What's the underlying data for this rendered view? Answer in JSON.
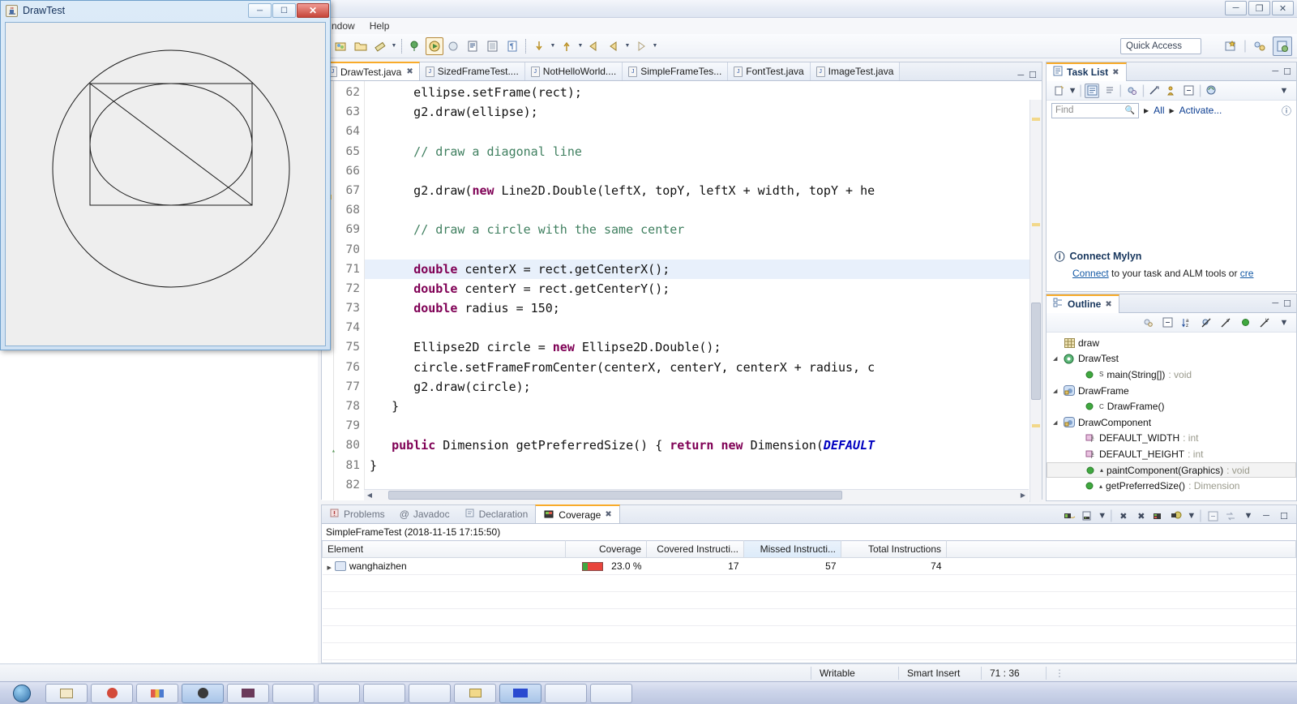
{
  "eclipse": {
    "window_buttons": [
      "minimize",
      "maximize",
      "close"
    ],
    "menu": [
      "ndow",
      "Help"
    ],
    "toolbar_icons": [
      "new-wizard-icon",
      "open-folder-icon",
      "save-icon",
      "dropdown-arrow",
      "debug-icon",
      "run-icon",
      "coverage-icon",
      "external-tools-icon",
      "new-java-class-icon",
      "open-type-icon",
      "toggle-markoccurrences-icon",
      "search-icon",
      "dropdown-arrow",
      "next-annotation-icon",
      "dropdown-arrow",
      "back-icon",
      "forward-icon",
      "dropdown-arrow",
      "forward2-icon",
      "dropdown-arrow"
    ],
    "quick_access": "Quick Access",
    "perspective_icons": [
      "new-perspective-icon",
      "java-perspective-icon",
      "java-ee-perspective-icon"
    ]
  },
  "editor": {
    "tabs": [
      {
        "label": "DrawTest.java",
        "active": true,
        "dirty": false
      },
      {
        "label": "SizedFrameTest....",
        "active": false
      },
      {
        "label": "NotHelloWorld....",
        "active": false
      },
      {
        "label": "SimpleFrameTes...",
        "active": false
      },
      {
        "label": "FontTest.java",
        "active": false
      },
      {
        "label": "ImageTest.java",
        "active": false
      }
    ],
    "first_line_number": 62,
    "highlighted_line": 71,
    "lines": [
      {
        "n": 62,
        "tokens": [
          {
            "t": "      ellipse.setFrame(rect);",
            "c": "pln"
          }
        ]
      },
      {
        "n": 63,
        "tokens": [
          {
            "t": "      g2.draw(ellipse);",
            "c": "pln"
          }
        ]
      },
      {
        "n": 64,
        "tokens": [
          {
            "t": "",
            "c": "pln"
          }
        ]
      },
      {
        "n": 65,
        "tokens": [
          {
            "t": "      // draw a diagonal line",
            "c": "cmt"
          }
        ]
      },
      {
        "n": 66,
        "tokens": [
          {
            "t": "",
            "c": "pln"
          }
        ]
      },
      {
        "n": 67,
        "tokens": [
          {
            "t": "      g2.draw(",
            "c": "pln"
          },
          {
            "t": "new",
            "c": "kw"
          },
          {
            "t": " Line2D.Double(leftX, topY, leftX + width, topY + he",
            "c": "pln"
          }
        ]
      },
      {
        "n": 68,
        "tokens": [
          {
            "t": "",
            "c": "pln"
          }
        ]
      },
      {
        "n": 69,
        "tokens": [
          {
            "t": "      // draw a circle with the same center",
            "c": "cmt"
          }
        ]
      },
      {
        "n": 70,
        "tokens": [
          {
            "t": "",
            "c": "pln"
          }
        ]
      },
      {
        "n": 71,
        "tokens": [
          {
            "t": "      ",
            "c": "pln"
          },
          {
            "t": "double",
            "c": "kw"
          },
          {
            "t": " centerX = rect.getCenterX();",
            "c": "pln"
          }
        ]
      },
      {
        "n": 72,
        "tokens": [
          {
            "t": "      ",
            "c": "pln"
          },
          {
            "t": "double",
            "c": "kw"
          },
          {
            "t": " centerY = rect.getCenterY();",
            "c": "pln"
          }
        ]
      },
      {
        "n": 73,
        "tokens": [
          {
            "t": "      ",
            "c": "pln"
          },
          {
            "t": "double",
            "c": "kw"
          },
          {
            "t": " radius = 150;",
            "c": "pln"
          }
        ]
      },
      {
        "n": 74,
        "tokens": [
          {
            "t": "",
            "c": "pln"
          }
        ]
      },
      {
        "n": 75,
        "tokens": [
          {
            "t": "      Ellipse2D circle = ",
            "c": "pln"
          },
          {
            "t": "new",
            "c": "kw"
          },
          {
            "t": " Ellipse2D.Double();",
            "c": "pln"
          }
        ]
      },
      {
        "n": 76,
        "tokens": [
          {
            "t": "      circle.setFrameFromCenter(centerX, centerY, centerX + radius, c",
            "c": "pln"
          }
        ]
      },
      {
        "n": 77,
        "tokens": [
          {
            "t": "      g2.draw(circle);",
            "c": "pln"
          }
        ]
      },
      {
        "n": 78,
        "tokens": [
          {
            "t": "   }",
            "c": "pln"
          }
        ]
      },
      {
        "n": 79,
        "tokens": [
          {
            "t": "",
            "c": "pln"
          }
        ]
      },
      {
        "n": 80,
        "tokens": [
          {
            "t": "   ",
            "c": "pln"
          },
          {
            "t": "public",
            "c": "kw"
          },
          {
            "t": " Dimension getPreferredSize() { ",
            "c": "pln"
          },
          {
            "t": "return",
            "c": "kw"
          },
          {
            "t": " ",
            "c": "pln"
          },
          {
            "t": "new",
            "c": "kw"
          },
          {
            "t": " Dimension(",
            "c": "pln"
          },
          {
            "t": "DEFAULT",
            "c": "stc"
          }
        ]
      },
      {
        "n": 81,
        "tokens": [
          {
            "t": "}",
            "c": "pln"
          }
        ]
      },
      {
        "n": 82,
        "tokens": [
          {
            "t": "",
            "c": "pln"
          }
        ]
      }
    ]
  },
  "task_list": {
    "title": "Task List",
    "toolbar_icons": [
      "new-task-icon",
      "dropdown-arrow",
      "categorized-view-icon",
      "scheduled-view-icon",
      "focus-icon",
      "clear-icon",
      "person-icon",
      "collapse-all-icon",
      "synchronize-icon",
      "view-menu-icon"
    ],
    "find_placeholder": "Find",
    "filter_all": "All",
    "filter_activate": "Activate...",
    "help_icon": "help-icon",
    "mylyn": {
      "title": "Connect Mylyn",
      "text_before": "Connect",
      "text_middle": " to your task and ALM tools or ",
      "text_link2": "cre"
    }
  },
  "outline": {
    "title": "Outline",
    "toolbar_icons": [
      "focus-on-active-task-icon",
      "collapse-all-icon",
      "sort-icon",
      "hide-fields-icon",
      "hide-static-icon",
      "hide-nonpublic-icon",
      "hide-local-types-icon",
      "view-menu-icon"
    ],
    "items": [
      {
        "label": "draw",
        "type": "",
        "icon": "package-icon",
        "indent": 0,
        "expandable": false,
        "selected": false
      },
      {
        "label": "DrawTest",
        "type": "",
        "icon": "class-icon",
        "indent": 0,
        "expandable": true,
        "selected": false
      },
      {
        "label": "main(String[])",
        "type": " : void",
        "icon": "method-public-static-icon",
        "indent": 1,
        "expandable": false,
        "selected": false
      },
      {
        "label": "DrawFrame",
        "type": "",
        "icon": "class-default-icon",
        "indent": 0,
        "expandable": true,
        "selected": false
      },
      {
        "label": "DrawFrame()",
        "type": "",
        "icon": "constructor-icon",
        "indent": 1,
        "expandable": false,
        "selected": false
      },
      {
        "label": "DrawComponent",
        "type": "",
        "icon": "class-default-icon",
        "indent": 0,
        "expandable": true,
        "selected": false
      },
      {
        "label": "DEFAULT_WIDTH",
        "type": " : int",
        "icon": "field-static-final-icon",
        "indent": 1,
        "expandable": false,
        "selected": false
      },
      {
        "label": "DEFAULT_HEIGHT",
        "type": " : int",
        "icon": "field-static-final-icon",
        "indent": 1,
        "expandable": false,
        "selected": false
      },
      {
        "label": "paintComponent(Graphics)",
        "type": " : void",
        "icon": "method-public-icon",
        "indent": 1,
        "expandable": false,
        "selected": true
      },
      {
        "label": "getPreferredSize()",
        "type": " : Dimension",
        "icon": "method-public-icon",
        "indent": 1,
        "expandable": false,
        "selected": false
      }
    ]
  },
  "coverage": {
    "tabs": [
      {
        "label": "Problems",
        "active": false,
        "icon": "problems-icon"
      },
      {
        "label": "Javadoc",
        "active": false,
        "icon": "javadoc-icon"
      },
      {
        "label": "Declaration",
        "active": false,
        "icon": "declaration-icon"
      },
      {
        "label": "Coverage",
        "active": true,
        "icon": "coverage-icon"
      }
    ],
    "toolbar_icons": [
      "session-icon",
      "import-session-icon",
      "dropdown-arrow",
      "remove-icon",
      "remove-all-icon",
      "relaunch-coverage-icon",
      "coverage-settings-icon",
      "dropdown-arrow",
      "collapse-all-icon",
      "link-with-selection-icon",
      "view-menu-icon",
      "minimize-icon",
      "maximize-icon"
    ],
    "session_title": "SimpleFrameTest (2018-11-15 17:15:50)",
    "columns": [
      "Element",
      "Coverage",
      "Covered Instructi...",
      "Missed Instructi...",
      "Total Instructions"
    ],
    "sorted_column": "Missed Instructi...",
    "rows": [
      {
        "element": "wanghaizhen",
        "coverage": "23.0 %",
        "covered": "17",
        "missed": "57",
        "total": "74",
        "bar_covered_pct": 23
      }
    ],
    "bar_colors": {
      "covered": "#3fa83f",
      "missed": "#e8453c"
    }
  },
  "statusbar": {
    "writable": "Writable",
    "insert_mode": "Smart Insert",
    "cursor_position": "71 : 36"
  },
  "drawtest_window": {
    "title": "DrawTest",
    "app_icon": "java-cup-icon",
    "buttons": [
      "minimize",
      "maximize",
      "close"
    ],
    "canvas": {
      "shapes": [
        "rectangle",
        "ellipse",
        "diagonal-line",
        "circle"
      ],
      "background": "#eeeeee",
      "stroke": "#1a1a1a"
    }
  },
  "taskbar": {
    "start_icon": "windows-start-orb",
    "items": [
      "item-1",
      "item-2",
      "item-3",
      "item-4",
      "item-5",
      "item-6",
      "item-7",
      "item-8",
      "item-9",
      "item-10",
      "item-11",
      "item-12",
      "item-13"
    ]
  }
}
